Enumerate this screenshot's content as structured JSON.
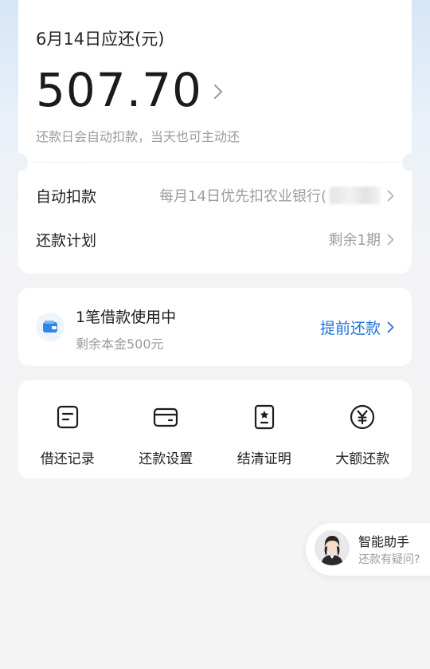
{
  "bill": {
    "due_title": "6月14日应还(元)",
    "amount": "507.70",
    "auto_note": "还款日会自动扣款，当天也可主动还"
  },
  "details": {
    "auto_debit_label": "自动扣款",
    "auto_debit_value": "每月14日优先扣农业银行(",
    "plan_label": "还款计划",
    "plan_value": "剩余1期"
  },
  "loan": {
    "title": "1笔借款使用中",
    "subtitle": "剩余本金500元",
    "prepay_label": "提前还款",
    "icon": "wallet-icon"
  },
  "actions": [
    {
      "label": "借还记录",
      "icon": "document-icon"
    },
    {
      "label": "还款设置",
      "icon": "card-icon"
    },
    {
      "label": "结清证明",
      "icon": "certificate-icon"
    },
    {
      "label": "大额还款",
      "icon": "yen-icon"
    }
  ],
  "assistant": {
    "title": "智能助手",
    "subtitle": "还款有疑问?"
  },
  "colors": {
    "accent": "#1f74d8",
    "muted_text": "#9b9b9b"
  }
}
